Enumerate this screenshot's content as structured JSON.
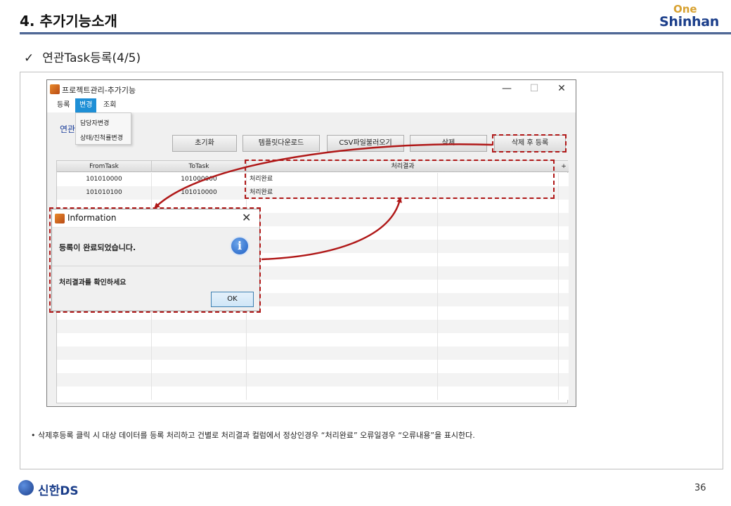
{
  "slide": {
    "title": "4. 추가기능소개",
    "subtitle_check": "✓",
    "subtitle": "연관Task등록(4/5)",
    "logo_top": "One",
    "logo_bottom": "Shinhan",
    "footnote": "• 삭제후등록 클릭 시 대상 데이터를 등록 처리하고 건별로 처리결과 컬럼에서 정상인경우 “처리완료” 오류일경우 “오류내용”을 표시한다.",
    "footer_logo": "신한DS",
    "page_number": "36"
  },
  "app": {
    "title": "프로젝트관리-추가기능",
    "minimize": "—",
    "maximize": "☐",
    "close": "✕",
    "menu": [
      "등록",
      "변경",
      "조회"
    ],
    "dropdown": [
      "담당자변경",
      "상태/진척률변경"
    ],
    "section_label": "연관",
    "buttons": {
      "reset": "초기화",
      "template_download": "템플릿다운로드",
      "csv_load": "CSV파일불러오기",
      "delete": "삭제",
      "delete_register": "삭제 후 등록"
    },
    "grid": {
      "headers": [
        "FromTask",
        "ToTask",
        "처리결과"
      ],
      "plus": "+",
      "rows": [
        [
          "101010000",
          "101000000",
          "처리완료"
        ],
        [
          "101010100",
          "101010000",
          "처리완료"
        ]
      ]
    }
  },
  "dialog": {
    "title": "Information",
    "close": "✕",
    "message": "등록이 완료되었습니다.",
    "icon": "i",
    "sub_message": "처리결과를 확인하세요",
    "ok": "OK"
  },
  "colors": {
    "annotation": "#b01818",
    "brand_blue": "#1b3e8a",
    "menu_highlight": "#1e8fd6"
  }
}
